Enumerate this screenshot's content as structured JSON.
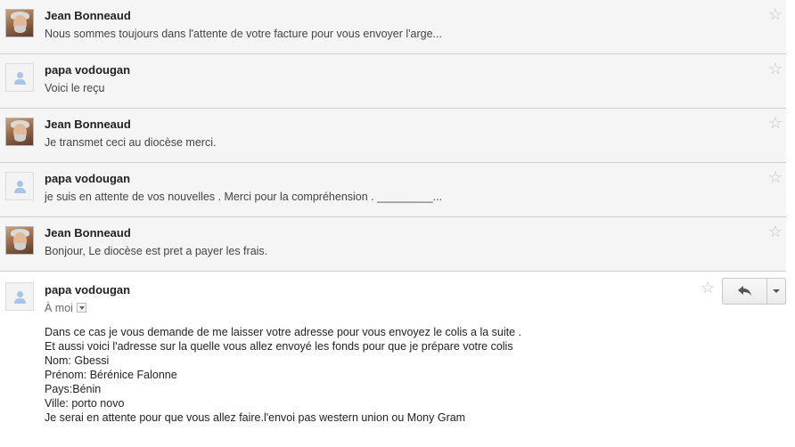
{
  "messages": [
    {
      "sender": "Jean Bonneaud",
      "snippet": "Nous sommes toujours dans l'attente de votre facture pour vous envoyer l'arge...",
      "avatar": "person-photo"
    },
    {
      "sender": "papa vodougan",
      "snippet": "Voici le reçu",
      "avatar": "default-avatar"
    },
    {
      "sender": "Jean Bonneaud",
      "snippet": "Je transmet ceci au diocèse merci.",
      "avatar": "person-photo"
    },
    {
      "sender": "papa vodougan",
      "snippet": "je suis en attente de vos nouvelles . Merci pour la compréhension . _________...",
      "avatar": "default-avatar"
    },
    {
      "sender": "Jean Bonneaud",
      "snippet": "Bonjour, Le diocèse est pret a payer les frais.",
      "avatar": "person-photo"
    }
  ],
  "expanded": {
    "sender": "papa vodougan",
    "to": "À moi",
    "avatar": "default-avatar",
    "body": [
      "Dans ce cas je vous demande de me laisser votre adresse pour vous envoyez le colis a la suite .",
      "Et aussi voici l'adresse sur la quelle vous allez envoyé les fonds pour que je prépare votre colis",
      "Nom: Gbessi",
      "Prénom: Bérénice Falonne",
      "Pays:Bénin",
      "Ville: porto novo",
      "Je serai en attente pour que vous allez faire.l'envoi pas western union ou Mony Gram"
    ]
  },
  "icons": {
    "star": "☆",
    "reply": "reply-icon",
    "more": "chevron-down-icon"
  }
}
